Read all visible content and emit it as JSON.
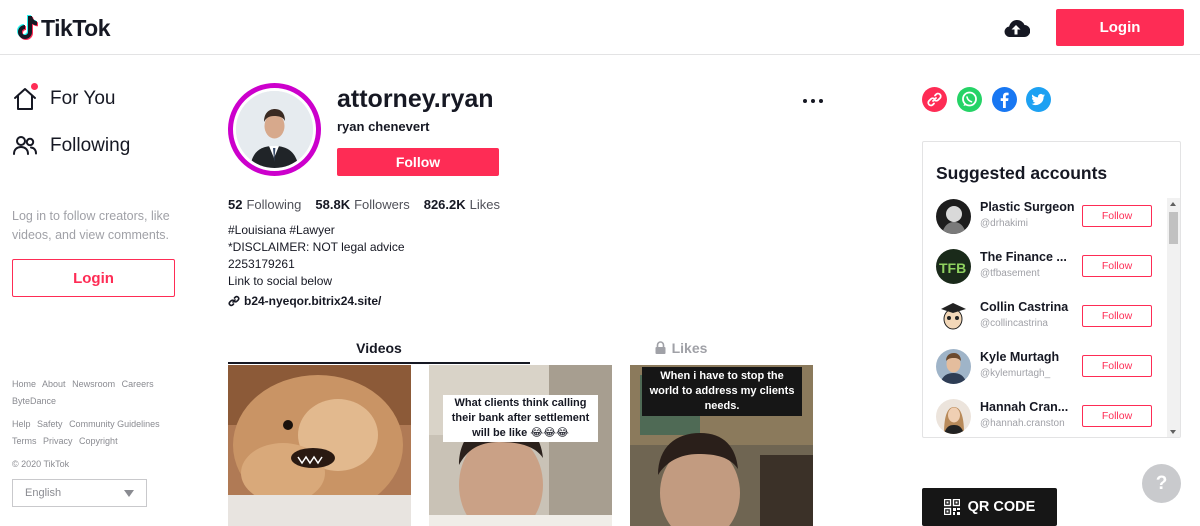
{
  "header": {
    "logo_text": "TikTok",
    "login_label": "Login",
    "upload_icon": "cloud-upload-icon"
  },
  "sidebar": {
    "nav": [
      {
        "label": "For You",
        "icon": "home-icon"
      },
      {
        "label": "Following",
        "icon": "people-icon"
      }
    ],
    "hint": "Log in to follow creators, like videos, and view comments.",
    "login_label": "Login",
    "footer_row1": [
      "Home",
      "About",
      "Newsroom",
      "Careers",
      "ByteDance"
    ],
    "footer_row2": [
      "Help",
      "Safety",
      "Community Guidelines",
      "Terms",
      "Privacy",
      "Copyright"
    ],
    "copyright": "© 2020 TikTok",
    "language": "English"
  },
  "profile": {
    "username": "attorney.ryan",
    "display_name": "ryan chenevert",
    "follow_label": "Follow",
    "stats": [
      {
        "value": "52",
        "label": "Following"
      },
      {
        "value": "58.8K",
        "label": "Followers"
      },
      {
        "value": "826.2K",
        "label": "Likes"
      }
    ],
    "bio_lines": [
      "#Louisiana #Lawyer",
      "*DISCLAIMER: NOT legal advice",
      "2253179261",
      "Link to social below"
    ],
    "link": "b24-nyeqor.bitrix24.site/"
  },
  "tabs": {
    "videos": "Videos",
    "likes": "Likes"
  },
  "videos": [
    {
      "caption": ""
    },
    {
      "caption": "What clients think calling their bank after settlement will be like 😂😂😂"
    },
    {
      "caption": "When i have to stop the world to address my clients needs."
    }
  ],
  "share_icons": [
    "link-icon",
    "whatsapp-icon",
    "facebook-icon",
    "twitter-icon"
  ],
  "suggested": {
    "title": "Suggested accounts",
    "follow_label": "Follow",
    "accounts": [
      {
        "name": "Plastic Surgeon",
        "handle": "@drhakimi"
      },
      {
        "name": "The Finance ...",
        "handle": "@tfbasement"
      },
      {
        "name": "Collin Castrina",
        "handle": "@collincastrina"
      },
      {
        "name": "Kyle Murtagh",
        "handle": "@kylemurtagh_"
      },
      {
        "name": "Hannah Cran...",
        "handle": "@hannah.cranston"
      }
    ]
  },
  "help_label": "?",
  "qr_label": "QR CODE"
}
